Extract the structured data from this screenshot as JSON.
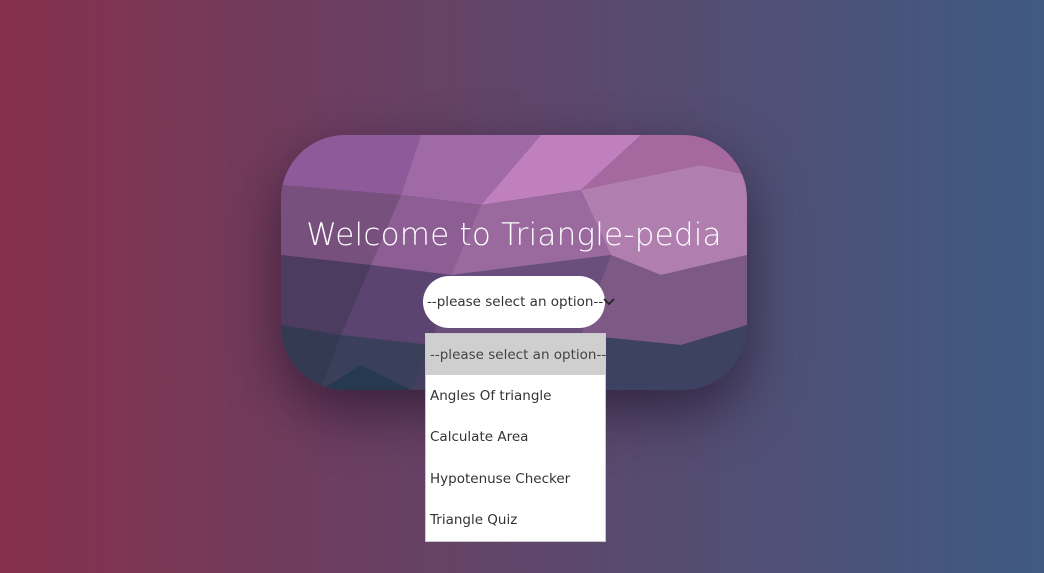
{
  "page": {
    "title": "Welcome to Triangle-pedia"
  },
  "select": {
    "value": "--please select an option--",
    "icon": "chevron-down-icon"
  },
  "dropdown": {
    "options": [
      {
        "label": "--please select an option--",
        "selected": true
      },
      {
        "label": "Angles Of triangle",
        "selected": false
      },
      {
        "label": "Calculate Area",
        "selected": false
      },
      {
        "label": "Hypotenuse Checker",
        "selected": false
      },
      {
        "label": "Triangle Quiz",
        "selected": false
      }
    ]
  },
  "colors": {
    "background_left": "#86304b",
    "background_right": "#3f5a82",
    "card": "#5b4173",
    "selected_option": "#cfcfcf"
  }
}
